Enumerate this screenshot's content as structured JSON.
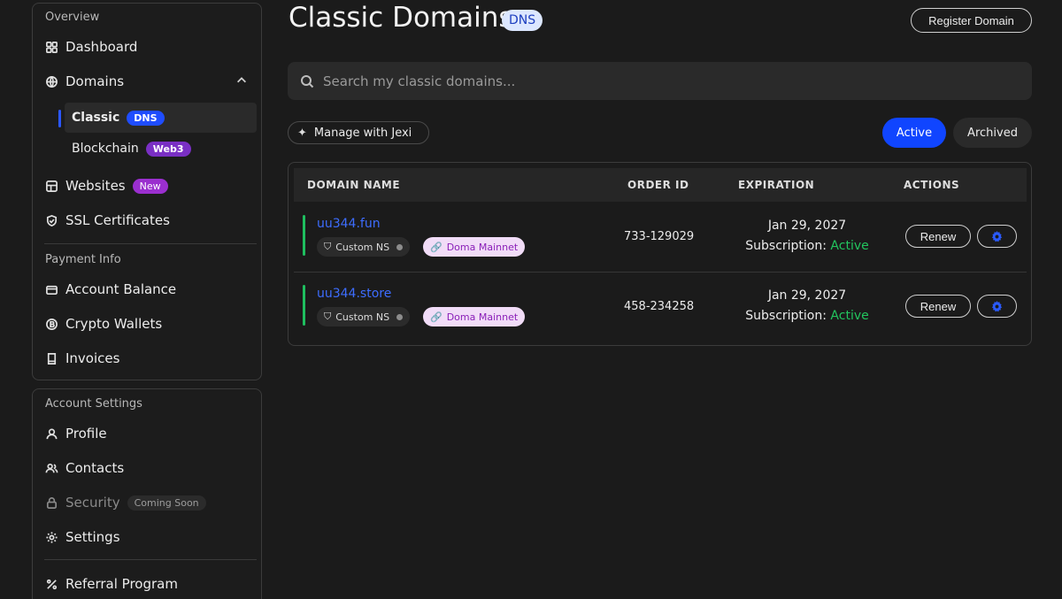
{
  "sidebar": {
    "overview_label": "Overview",
    "dashboard": "Dashboard",
    "domains": "Domains",
    "classic": "Classic",
    "classic_badge": "DNS",
    "blockchain": "Blockchain",
    "blockchain_badge": "Web3",
    "websites": "Websites",
    "websites_badge": "New",
    "ssl": "SSL Certificates",
    "payment_label": "Payment Info",
    "account_balance": "Account Balance",
    "crypto_wallets": "Crypto Wallets",
    "invoices": "Invoices",
    "account_settings_label": "Account Settings",
    "profile": "Profile",
    "contacts": "Contacts",
    "security": "Security",
    "security_badge": "Coming Soon",
    "settings": "Settings",
    "referral": "Referral Program"
  },
  "header": {
    "title": "Classic Domains",
    "title_badge": "DNS",
    "register_button": "Register Domain"
  },
  "search": {
    "placeholder": "Search my classic domains..."
  },
  "toolbar": {
    "manage_jexi": "Manage with Jexi",
    "active_tab": "Active",
    "archived_tab": "Archived"
  },
  "table": {
    "columns": [
      "DOMAIN NAME",
      "ORDER ID",
      "EXPIRATION",
      "ACTIONS"
    ],
    "rows": [
      {
        "domain": "uu344.fun",
        "ns_tag": "Custom NS",
        "network_tag": "Doma Mainnet",
        "order_id": "733-129029",
        "expiration_date": "Jan 29, 2027",
        "subscription_label": "Subscription:",
        "subscription_status": "Active",
        "renew_label": "Renew"
      },
      {
        "domain": "uu344.store",
        "ns_tag": "Custom NS",
        "network_tag": "Doma Mainnet",
        "order_id": "458-234258",
        "expiration_date": "Jan 29, 2027",
        "subscription_label": "Subscription:",
        "subscription_status": "Active",
        "renew_label": "Renew"
      }
    ]
  },
  "colors": {
    "accent_blue": "#1045ff",
    "status_green": "#22c55e",
    "web3_purple": "#7a2fc4"
  }
}
